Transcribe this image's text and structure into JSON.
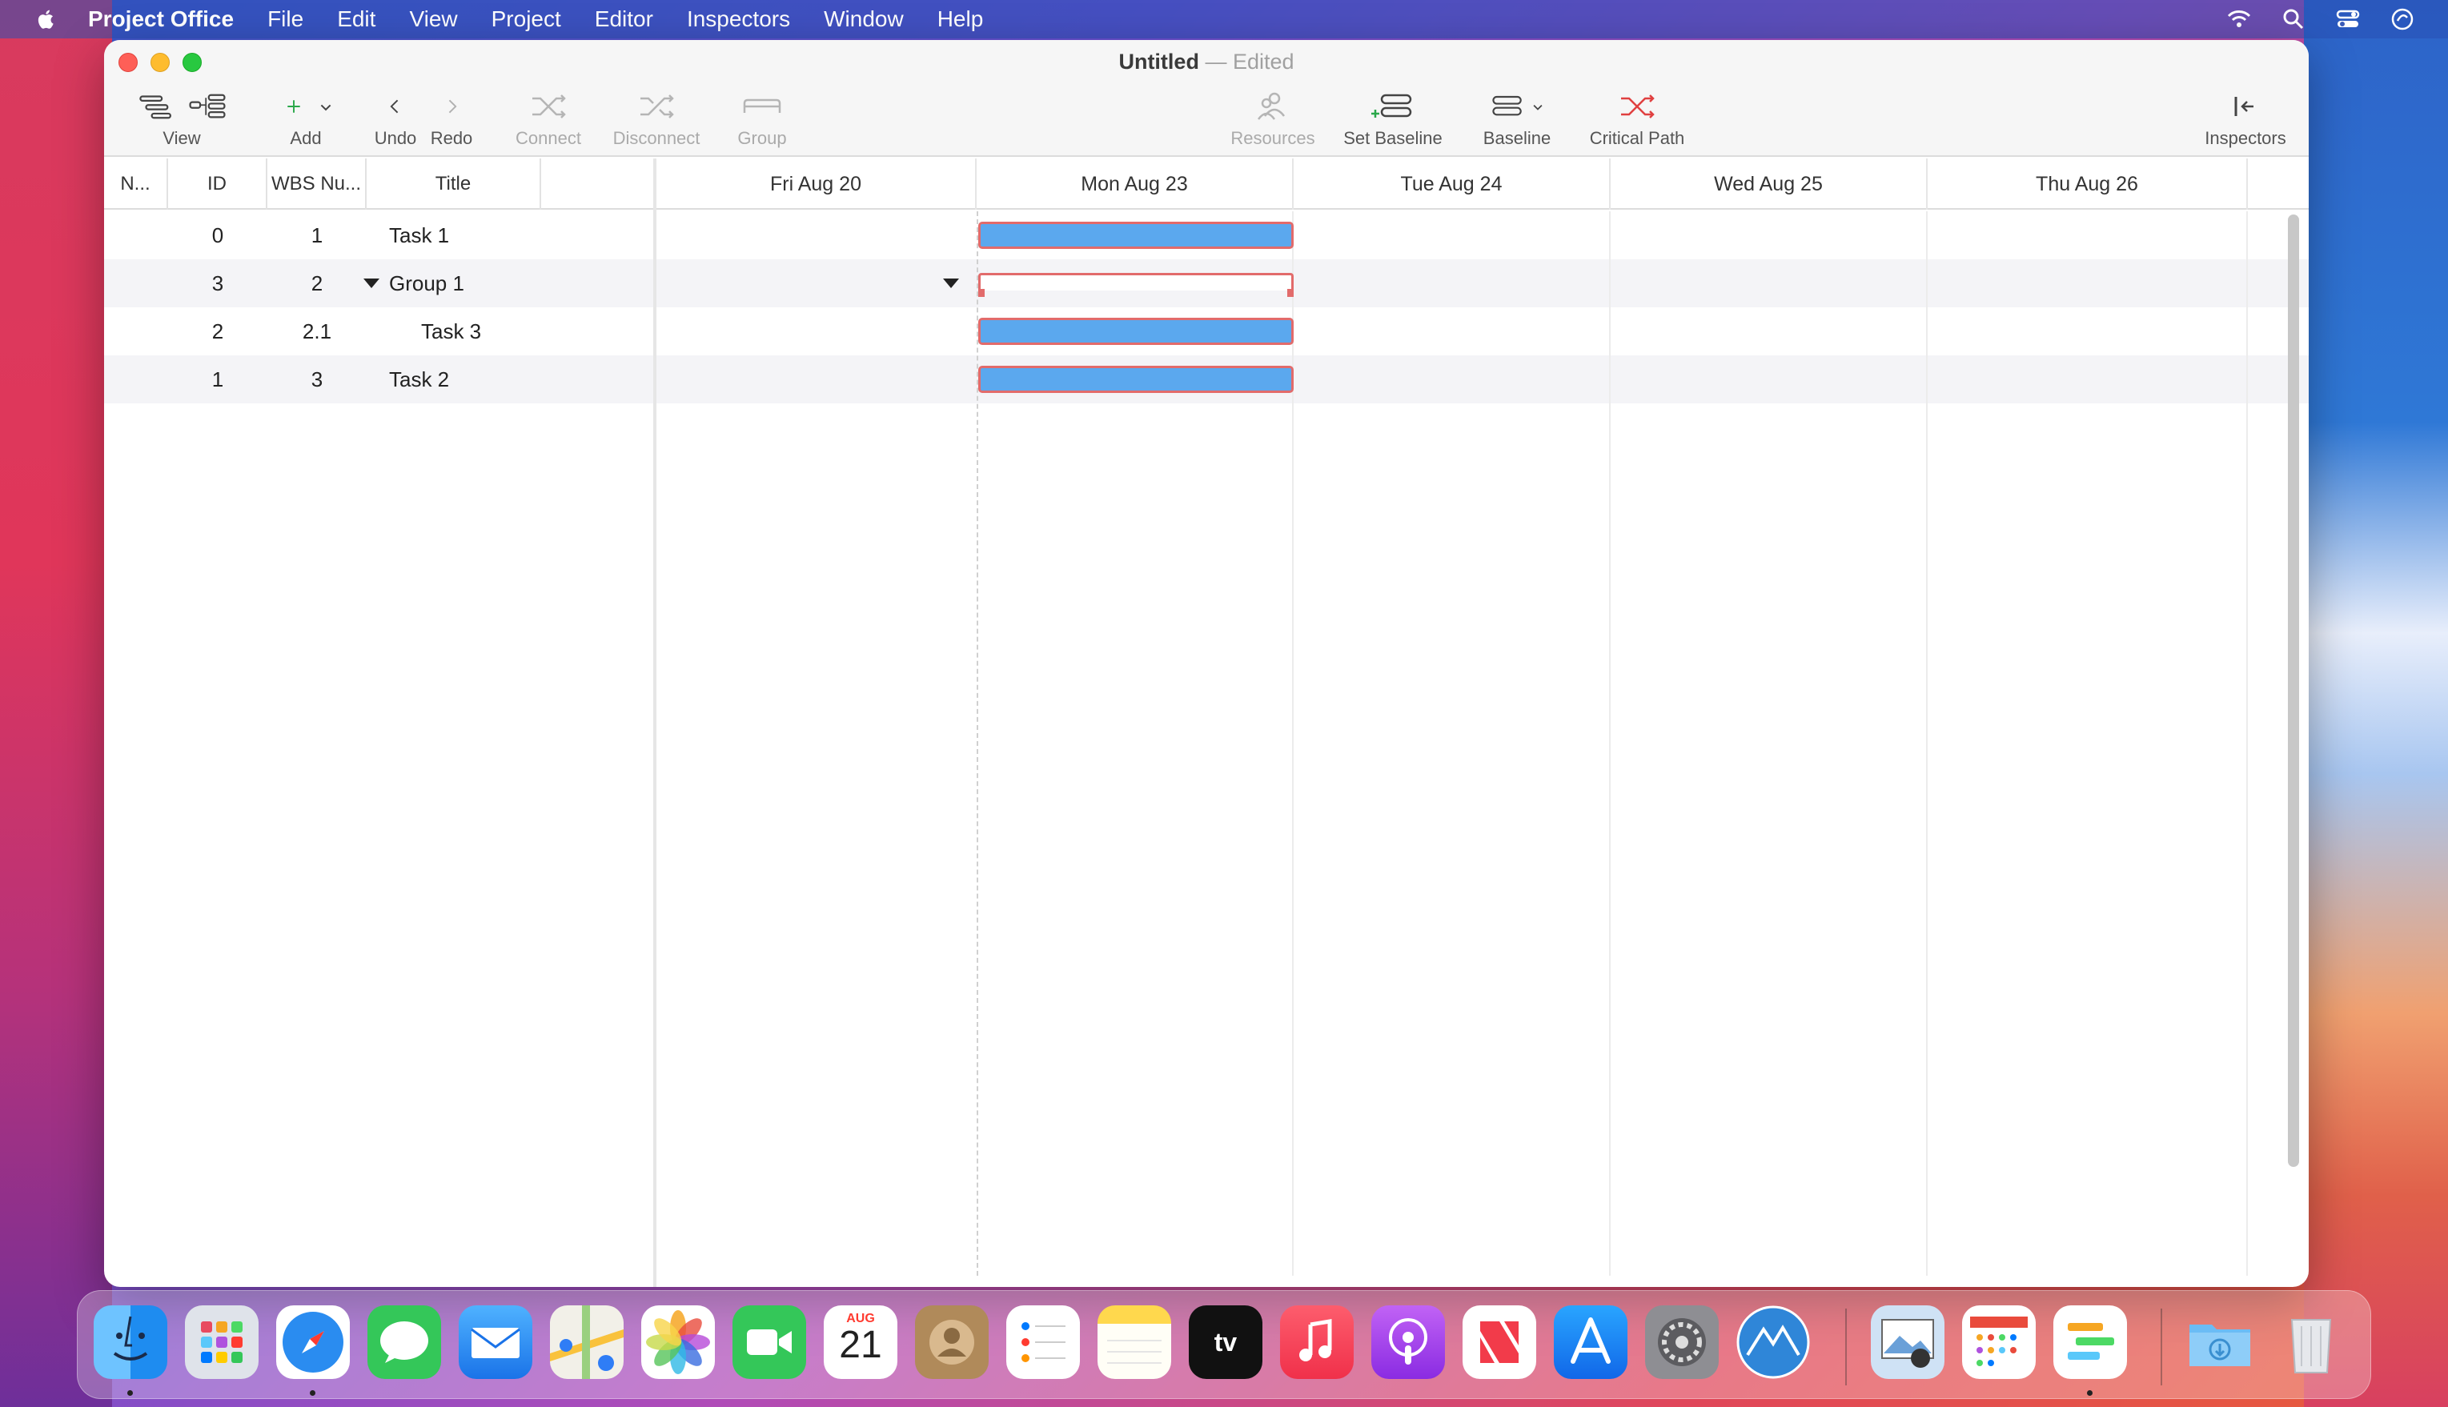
{
  "menubar": {
    "app_name": "Project Office",
    "items": [
      "File",
      "Edit",
      "View",
      "Project",
      "Editor",
      "Inspectors",
      "Window",
      "Help"
    ],
    "status_icons": [
      "wifi-icon",
      "search-icon",
      "control-center-icon",
      "siri-icon"
    ]
  },
  "window": {
    "title": "Untitled",
    "separator": "—",
    "status": "Edited"
  },
  "toolbar": {
    "view": "View",
    "add": "Add",
    "undo": "Undo",
    "redo": "Redo",
    "connect": "Connect",
    "disconnect": "Disconnect",
    "group": "Group",
    "resources": "Resources",
    "set_baseline": "Set Baseline",
    "baseline": "Baseline",
    "critical_path": "Critical Path",
    "inspectors": "Inspectors"
  },
  "table": {
    "columns": [
      "N...",
      "ID",
      "WBS Nu...",
      "Title"
    ],
    "rows": [
      {
        "id": "0",
        "wbs": "1",
        "title": "Task 1"
      },
      {
        "id": "3",
        "wbs": "2",
        "title": "Group 1"
      },
      {
        "id": "2",
        "wbs": "2.1",
        "title": "Task 3"
      },
      {
        "id": "1",
        "wbs": "3",
        "title": "Task 2"
      }
    ]
  },
  "gantt": {
    "days": [
      "Fri Aug 20",
      "Mon Aug 23",
      "Tue Aug 24",
      "Wed Aug 25",
      "Thu Aug 26"
    ]
  },
  "dock": {
    "apps": [
      "Finder",
      "Launchpad",
      "Safari",
      "Messages",
      "Mail",
      "Maps",
      "Photos",
      "FaceTime",
      "Calendar",
      "Contacts",
      "Reminders",
      "Notes",
      "TV",
      "Music",
      "Podcasts",
      "News",
      "App Store",
      "System Preferences",
      "Project Office",
      "Preview",
      "Calendar Plus",
      "Project Office Document",
      "Downloads",
      "Trash"
    ],
    "calendar_month": "AUG",
    "calendar_day": "21",
    "tv_label": "tv"
  },
  "colors": {
    "task_bar_fill": "#5ba8ee",
    "task_bar_border": "#e26b6b",
    "alt_row": "#f4f4f7"
  }
}
